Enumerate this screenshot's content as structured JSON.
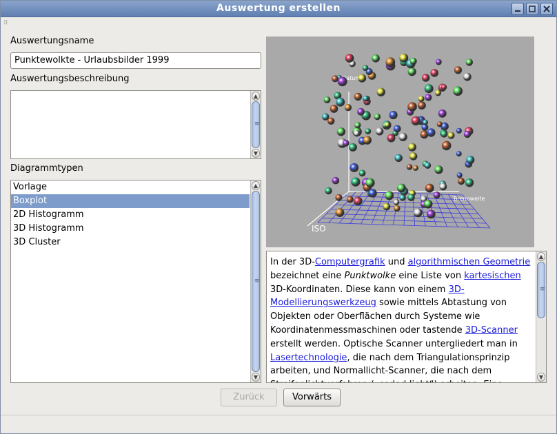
{
  "window": {
    "title": "Auswertung erstellen"
  },
  "form": {
    "name_label": "Auswertungsname",
    "name_value": "Punktewolkte - Urlaubsbilder 1999",
    "description_label": "Auswertungsbeschreibung",
    "description_value": "",
    "diagram_types_label": "Diagrammtypen",
    "diagram_types": [
      {
        "label": "Vorlage",
        "selected": false
      },
      {
        "label": "Boxplot",
        "selected": true
      },
      {
        "label": "2D Histogramm",
        "selected": false
      },
      {
        "label": "3D Histogramm",
        "selected": false
      },
      {
        "label": "3D Cluster",
        "selected": false
      }
    ]
  },
  "preview": {
    "axis_y_label": "Datum",
    "axis_x_label": "Brennweite",
    "axis_z_label": "ISO"
  },
  "info": {
    "t1": "In der 3D-",
    "l1": "Computergrafik",
    "t2": " und ",
    "l2": "algorithmischen Geometrie",
    "t3": " bezeichnet eine ",
    "em1": "Punktwolke",
    "t4": " eine Liste von ",
    "l3": "kartesischen",
    "t5": " 3D-Koordinaten. Diese kann von einem ",
    "l4": "3D-Modellierungswerkzeug",
    "t6": " sowie mittels Abtastung von Objekten oder Oberflächen durch Systeme wie Koordinatenmessmaschinen oder tastende ",
    "l5": "3D-Scanner",
    "t7": " erstellt werden. Optische Scanner untergliedert man in ",
    "l6": "Lasertechnologie",
    "t8": ", die nach dem Triangulationsprinzip arbeiten, und Normallicht-Scanner, die nach dem Streifenlichtverfahren („coded-light“) arbeiten. Eine"
  },
  "buttons": {
    "back": "Zurück",
    "forward": "Vorwärts"
  },
  "colors": {
    "titlebar": "#6f8cbc",
    "selection": "#7d9ccc",
    "link": "#1a1adb",
    "grid": "#3a3ae0"
  }
}
